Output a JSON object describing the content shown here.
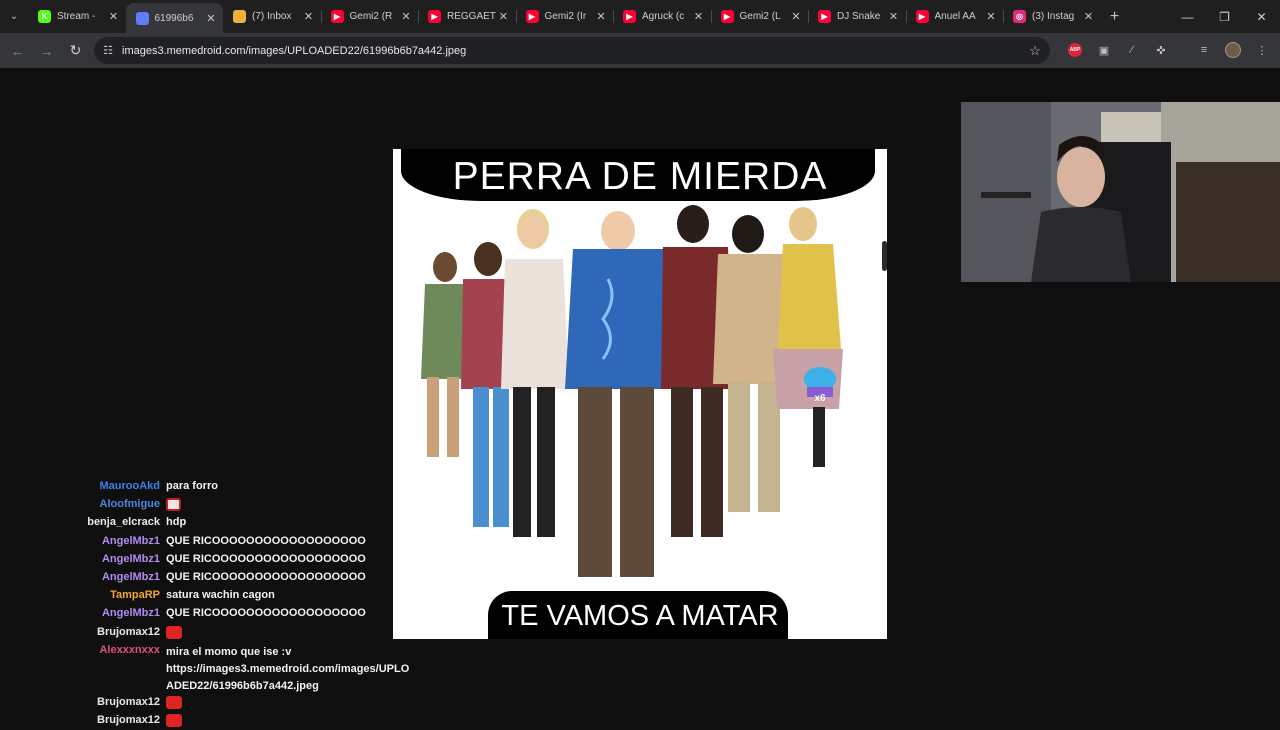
{
  "tabs": [
    {
      "title": "Stream -",
      "fav": "K",
      "fav_color": "#53fc18",
      "active": false
    },
    {
      "title": "61996b6",
      "fav": "",
      "fav_color": "#5f7cff",
      "active": true
    },
    {
      "title": "(7) Inbox",
      "fav": "",
      "fav_color": "#f0b13b",
      "active": false
    },
    {
      "title": "Gemi2 (R",
      "fav": "▶",
      "fav_color": "#ff0033",
      "active": false
    },
    {
      "title": "REGGAET",
      "fav": "▶",
      "fav_color": "#ff0033",
      "active": false
    },
    {
      "title": "Gemi2 (Ir",
      "fav": "▶",
      "fav_color": "#ff0033",
      "active": false
    },
    {
      "title": "Agruck (c",
      "fav": "▶",
      "fav_color": "#ff0033",
      "active": false
    },
    {
      "title": "Gemi2 (L",
      "fav": "▶",
      "fav_color": "#ff0033",
      "active": false
    },
    {
      "title": "DJ Snake",
      "fav": "▶",
      "fav_color": "#ff0033",
      "active": false
    },
    {
      "title": "Anuel AA",
      "fav": "▶",
      "fav_color": "#ff0033",
      "active": false
    },
    {
      "title": "(3) Instag",
      "fav": "◎",
      "fav_color": "#dd2a7b",
      "active": false
    }
  ],
  "address": {
    "url": "images3.memedroid.com/images/UPLOADED22/61996b6b7a442.jpeg"
  },
  "meme": {
    "top_text": "PERRA DE MIERDA",
    "bottom_text": "TE VAMOS A MATAR"
  },
  "chat": [
    {
      "user": "MaurooAkd",
      "color": "#3d7ef0",
      "text": "para forro"
    },
    {
      "user": "Aloofmigue",
      "color": "#4a86e0",
      "emote": "cake"
    },
    {
      "user": "benja_elcrack",
      "color": "#e8e8e8",
      "text": "hdp"
    },
    {
      "user": "AngelMbz1",
      "color": "#b08cf0",
      "text": "QUE RICOOOOOOOOOOOOOOOOOO"
    },
    {
      "user": "AngelMbz1",
      "color": "#b08cf0",
      "text": "QUE RICOOOOOOOOOOOOOOOOOO"
    },
    {
      "user": "AngelMbz1",
      "color": "#b08cf0",
      "text": "QUE RICOOOOOOOOOOOOOOOOOO"
    },
    {
      "user": "TampaRP",
      "color": "#f0a830",
      "text": "satura wachin cagon"
    },
    {
      "user": "AngelMbz1",
      "color": "#b08cf0",
      "text": "QUE RICOOOOOOOOOOOOOOOOOO"
    },
    {
      "user": "Brujomax12",
      "color": "#e8e8e8",
      "emote": "red"
    },
    {
      "user": "Alexxxnxxx",
      "color": "#e0507a",
      "text": "mira el momo que ise :v",
      "text2": "https://images3.memedroid.com/images/UPLO",
      "text3": "ADED22/61996b6b7a442.jpeg"
    },
    {
      "user": "Brujomax12",
      "color": "#e8e8e8",
      "emote": "red"
    },
    {
      "user": "Brujomax12",
      "color": "#e8e8e8",
      "emote": "red"
    }
  ]
}
